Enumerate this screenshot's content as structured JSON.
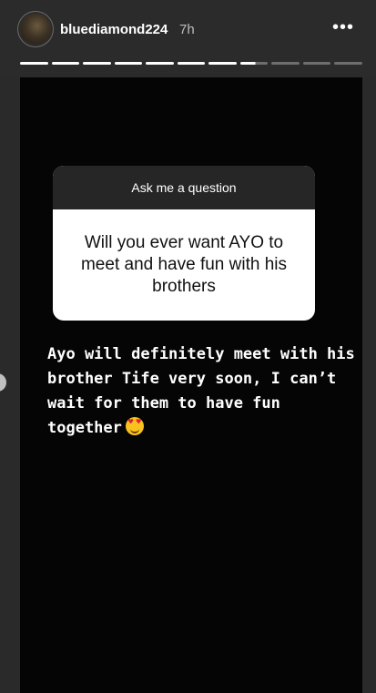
{
  "header": {
    "username": "bluediamond224",
    "time": "7h",
    "more_icon": "•••"
  },
  "progress": {
    "total_segments": 11,
    "completed_segments": 7,
    "current_fraction": 0.55
  },
  "question_sticker": {
    "title": "Ask me a question",
    "question": "Will you ever want AYO to meet and have fun with his brothers"
  },
  "answer_text": "Ayo will definitely meet with his brother Tife very soon, I can’t wait for them to have fun together",
  "icons": {
    "emoji": "smiling-face-with-heart-eyes"
  }
}
